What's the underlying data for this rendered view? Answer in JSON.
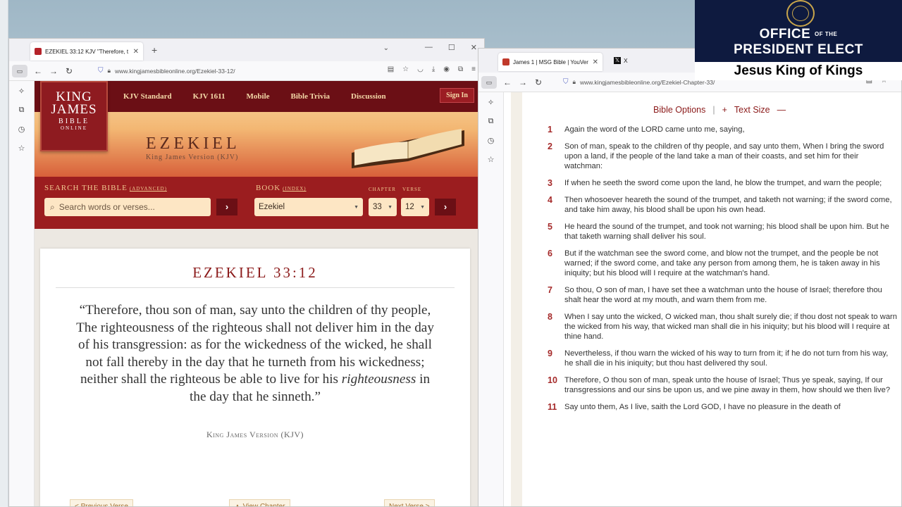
{
  "left_window": {
    "tab_title": "EZEKIEL 33:12 KJV \"Therefore, t",
    "url": "www.kingjamesbibleonline.org/Ezekiel-33-12/",
    "nav": [
      "KJV Standard",
      "KJV 1611",
      "Mobile",
      "Bible Trivia",
      "Discussion"
    ],
    "sign_in": "Sign In",
    "logo": {
      "line1": "KING",
      "line2": "JAMES",
      "line3": "BIBLE",
      "line4": "ONLINE"
    },
    "book_title": "EZEKIEL",
    "book_subtitle": "King James Version (KJV)",
    "search": {
      "label": "SEARCH THE BIBLE",
      "label_small": "(ADVANCED)",
      "placeholder": "Search words or verses...",
      "book_label": "BOOK",
      "book_label_small": "(INDEX)",
      "chapter_label": "CHAPTER",
      "verse_label": "VERSE",
      "book_value": "Ezekiel",
      "chapter_value": "33",
      "verse_value": "12"
    },
    "verse_ref": "EZEKIEL 33:12",
    "verse_text_a": "“Therefore, thou son of man, say unto the children of thy people, The righteousness of the righteous shall not deliver him in the day of his transgression: as for the wickedness of the wicked, he shall not fall thereby in the day that he turneth from his wickedness; neither shall the righteous be able to live for his ",
    "verse_text_italic": "righteousness",
    "verse_text_b": " in the day that he sinneth.”",
    "version": "King James Version (KJV)",
    "pager": {
      "prev": "< Previous Verse",
      "chapter": "▲ View Chapter",
      "next": "Next Verse >"
    }
  },
  "right_window": {
    "tab1": "James 1 | MSG Bible | YouVer",
    "tab2": "X",
    "url": "www.kingjamesbibleonline.org/Ezekiel-Chapter-33/",
    "options": {
      "bible_options": "Bible Options",
      "sep": "|",
      "plus": "+",
      "text_size": "Text Size",
      "minus": "—"
    },
    "verses": [
      {
        "n": "1",
        "t": "Again the word of the LORD came unto me, saying,"
      },
      {
        "n": "2",
        "t": "Son of man, speak to the children of thy people, and say unto them, When I bring the sword upon a land, if the people of the land take a man of their coasts, and set him for their watchman:"
      },
      {
        "n": "3",
        "t": "If when he seeth the sword come upon the land, he blow the trumpet, and warn the people;"
      },
      {
        "n": "4",
        "t": "Then whosoever heareth the sound of the trumpet, and taketh not warning; if the sword come, and take him away, his blood shall be upon his own head."
      },
      {
        "n": "5",
        "t": "He heard the sound of the trumpet, and took not warning; his blood shall be upon him. But he that taketh warning shall deliver his soul."
      },
      {
        "n": "6",
        "t": "But if the watchman see the sword come, and blow not the trumpet, and the people be not warned; if the sword come, and take any person from among them, he is taken away in his iniquity; but his blood will I require at the watchman's hand."
      },
      {
        "n": "7",
        "t": "So thou, O son of man, I have set thee a watchman unto the house of Israel; therefore thou shalt hear the word at my mouth, and warn them from me."
      },
      {
        "n": "8",
        "t": "When I say unto the wicked, O wicked man, thou shalt surely die; if thou dost not speak to warn the wicked from his way, that wicked man shall die in his iniquity; but his blood will I require at thine hand."
      },
      {
        "n": "9",
        "t": "Nevertheless, if thou warn the wicked of his way to turn from it; if he do not turn from his way, he shall die in his iniquity; but thou hast delivered thy soul."
      },
      {
        "n": "10",
        "t": "Therefore, O thou son of man, speak unto the house of Israel; Thus ye speak, saying, If our transgressions and our sins be upon us, and we pine away in them, how should we then live?"
      },
      {
        "n": "11",
        "t": "Say unto them, As I live, saith the Lord GOD, I have no pleasure in the death of"
      }
    ]
  },
  "overlay": {
    "office": "OFFICE",
    "of_the": "OF THE",
    "president_elect": "PRESIDENT ELECT",
    "caption": "Jesus King of Kings"
  },
  "colors": {
    "kjv_red": "#9b1d1f",
    "kjv_dark": "#6b0f15",
    "verse_red": "#8b1a1a",
    "overlay_navy": "#0e1a3f"
  }
}
